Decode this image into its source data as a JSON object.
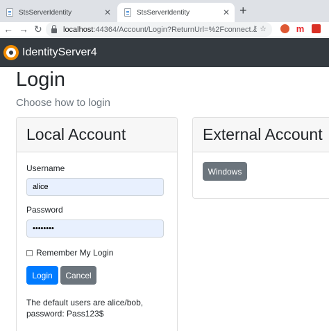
{
  "browser": {
    "tabs": [
      {
        "title": "StsServerIdentity",
        "close": "✕"
      },
      {
        "title": "StsServerIdentity",
        "close": "✕"
      }
    ],
    "new_tab": "+",
    "nav": {
      "back": "←",
      "forward": "→",
      "reload": "↻"
    },
    "url": {
      "host": "localhost",
      "path": ":44364/Account/Login?ReturnUrl=%2Fconnect..."
    },
    "omni_icons": "⚷ ☆",
    "extensions": [
      {
        "icon": "duckduckgo-icon",
        "color": "#de5833"
      },
      {
        "icon": "m-extension-icon",
        "glyph": "m",
        "color": "#e8262a"
      },
      {
        "icon": "pdf-extension-icon",
        "color": "#d93025"
      }
    ]
  },
  "navbar": {
    "brand": "IdentityServer4"
  },
  "page": {
    "title": "Login",
    "subtitle": "Choose how to login"
  },
  "local": {
    "header": "Local Account",
    "username_label": "Username",
    "username_value": "alice",
    "password_label": "Password",
    "password_value": "••••••••",
    "remember_label": "Remember My Login",
    "login_button": "Login",
    "cancel_button": "Cancel",
    "hint": "The default users are alice/bob, password: Pass123$"
  },
  "external": {
    "header": "External Account",
    "windows_button": "Windows"
  },
  "colors": {
    "navbar": "#343a40",
    "primary": "#007bff",
    "secondary": "#6c757d",
    "autofill": "#e8f0fe"
  }
}
